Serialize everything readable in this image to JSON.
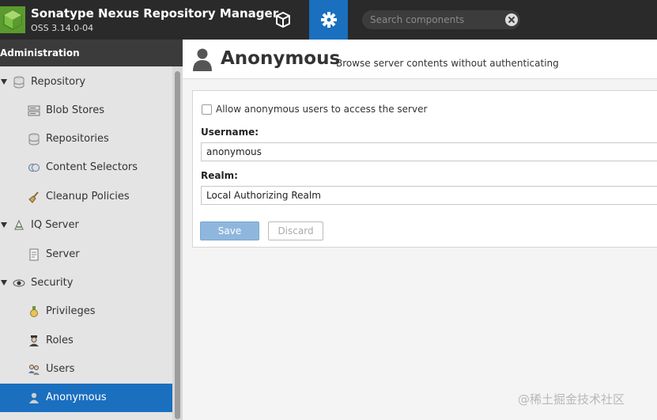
{
  "header": {
    "app_title": "Sonatype Nexus Repository Manager",
    "app_version": "OSS 3.14.0-04",
    "logo_icon": "nexus-cube-logo",
    "nav_browse_icon": "cube-icon",
    "nav_admin_icon": "gear-icon",
    "search_placeholder": "Search components",
    "accent_color": "#1a6fbf"
  },
  "sidebar": {
    "title": "Administration",
    "items": [
      {
        "label": "Repository",
        "icon": "database-icon",
        "level": 0,
        "expanded": true
      },
      {
        "label": "Blob Stores",
        "icon": "server-stack-icon",
        "level": 1
      },
      {
        "label": "Repositories",
        "icon": "database-icon",
        "level": 1
      },
      {
        "label": "Content Selectors",
        "icon": "selector-icon",
        "level": 1
      },
      {
        "label": "Cleanup Policies",
        "icon": "broom-icon",
        "level": 1
      },
      {
        "label": "IQ Server",
        "icon": "iq-server-icon",
        "level": 0,
        "expanded": true
      },
      {
        "label": "Server",
        "icon": "document-icon",
        "level": 1
      },
      {
        "label": "Security",
        "icon": "eye-icon",
        "level": 0,
        "expanded": true
      },
      {
        "label": "Privileges",
        "icon": "medal-icon",
        "level": 1
      },
      {
        "label": "Roles",
        "icon": "role-icon",
        "level": 1
      },
      {
        "label": "Users",
        "icon": "users-icon",
        "level": 1
      },
      {
        "label": "Anonymous",
        "icon": "user-icon",
        "level": 1,
        "selected": true
      }
    ]
  },
  "page": {
    "title": "Anonymous",
    "subtitle": "Browse server contents without authenticating",
    "icon": "user-icon"
  },
  "form": {
    "allow_label": "Allow anonymous users to access the server",
    "allow_checked": false,
    "username_label": "Username:",
    "username_value": "anonymous",
    "realm_label": "Realm:",
    "realm_value": "Local Authorizing Realm",
    "save_label": "Save",
    "discard_label": "Discard"
  },
  "watermark": "@稀土掘金技术社区"
}
